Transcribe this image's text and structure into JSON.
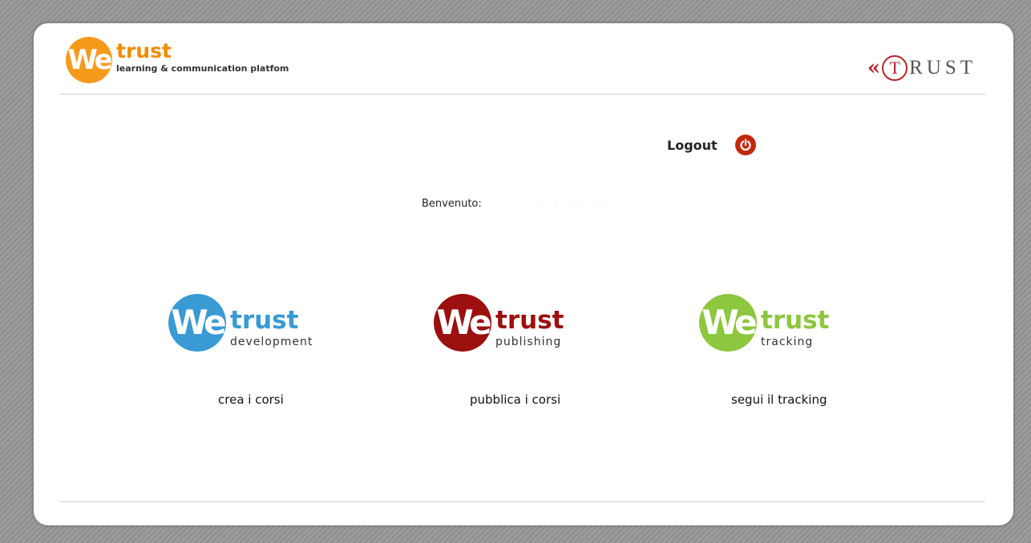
{
  "header": {
    "logo": {
      "mark": "We",
      "word": "trust",
      "tagline": "learning & communication platfom"
    },
    "partner_logo": {
      "chevrons": "«",
      "initial": "T",
      "rest": "RUST"
    }
  },
  "logout": {
    "label": "Logout"
  },
  "welcome": {
    "label": "Benvenuto:",
    "name": "· · · · · ·"
  },
  "modules": [
    {
      "mark": "We",
      "word": "trust",
      "sub": "development",
      "caption": "crea i corsi",
      "color": "#3a9ad4"
    },
    {
      "mark": "We",
      "word": "trust",
      "sub": "publishing",
      "caption": "pubblica i corsi",
      "color": "#9c1010"
    },
    {
      "mark": "We",
      "word": "trust",
      "sub": "tracking",
      "caption": "segui il tracking",
      "color": "#8dc63f"
    }
  ],
  "colors": {
    "brand_orange": "#f79a1c",
    "trust_red": "#b5252a",
    "logout_red": "#c2290c"
  }
}
